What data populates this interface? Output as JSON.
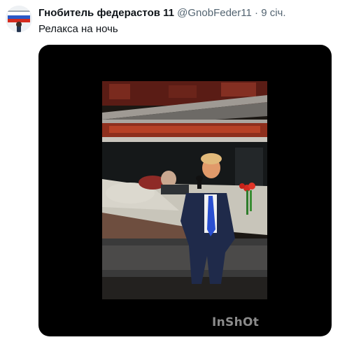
{
  "tweet": {
    "display_name": "Гнобитель федерастов 11",
    "handle": "@GnobFeder11",
    "separator": "·",
    "time": "9 січ.",
    "text": "Релакса на ночь"
  },
  "media": {
    "type": "video",
    "watermark": "InShOt",
    "background_color": "#000000"
  },
  "icons": {
    "avatar": "profile-avatar-flag"
  }
}
